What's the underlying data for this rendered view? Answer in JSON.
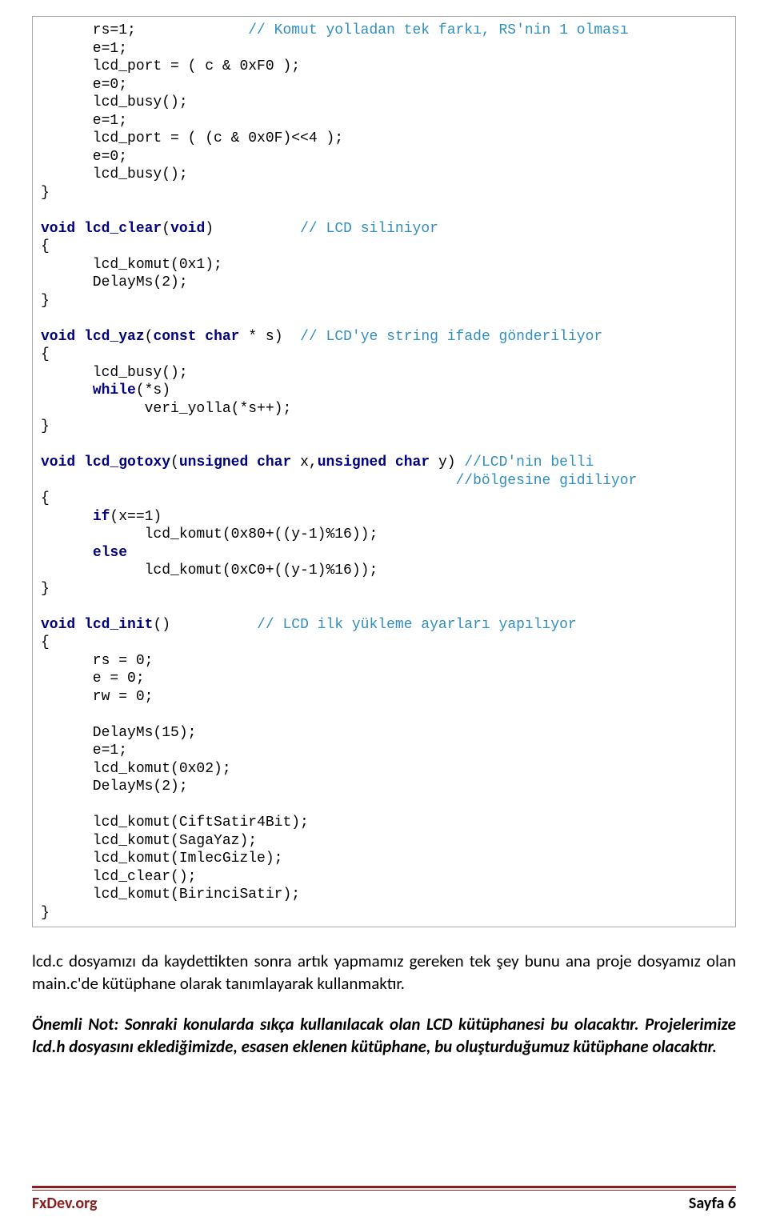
{
  "code": {
    "l1a": "      rs=1;             ",
    "l1b": "// Komut yolladan tek farkı, RS'nin 1 olması",
    "l2": "      e=1;",
    "l3": "      lcd_port = ( c & 0xF0 );",
    "l4": "      e=0;",
    "l5": "      lcd_busy();",
    "l6": "      e=1;",
    "l7": "      lcd_port = ( (c & 0x0F)<<4 );",
    "l8": "      e=0;",
    "l9": "      lcd_busy();",
    "l10": "}",
    "l12a": "void",
    "l12b": " lcd_clear",
    "l12c": "(",
    "l12d": "void",
    "l12e": ")          ",
    "l12f": "// LCD siliniyor",
    "l13": "{",
    "l14": "      lcd_komut(0x1);",
    "l15": "      DelayMs(2);",
    "l16": "}",
    "l18a": "void",
    "l18b": " lcd_yaz",
    "l18c": "(",
    "l18d": "const char",
    "l18e": " * s)  ",
    "l18f": "// LCD'ye string ifade gönderiliyor",
    "l19": "{",
    "l20": "      lcd_busy();",
    "l21a": "      ",
    "l21b": "while",
    "l21c": "(*s)",
    "l22": "            veri_yolla(*s++);",
    "l23": "}",
    "l25a": "void",
    "l25b": " lcd_gotoxy",
    "l25c": "(",
    "l25d": "unsigned char",
    "l25e": " x,",
    "l25f": "unsigned char",
    "l25g": " y) ",
    "l25h": "//LCD'nin belli",
    "l26": "                                                //bölgesine gidiliyor",
    "l27": "{",
    "l28a": "      ",
    "l28b": "if",
    "l28c": "(x==1)",
    "l29": "            lcd_komut(0x80+((y-1)%16));",
    "l30a": "      ",
    "l30b": "else",
    "l31": "            lcd_komut(0xC0+((y-1)%16));",
    "l32": "}",
    "l34a": "void",
    "l34b": " lcd_init",
    "l34c": "()          ",
    "l34d": "// LCD ilk yükleme ayarları yapılıyor",
    "l35": "{",
    "l36": "      rs = 0;",
    "l37": "      e = 0;",
    "l38": "      rw = 0;",
    "l40": "      DelayMs(15);",
    "l41": "      e=1;",
    "l42": "      lcd_komut(0x02);",
    "l43": "      DelayMs(2);",
    "l45": "      lcd_komut(CiftSatir4Bit);",
    "l46": "      lcd_komut(SagaYaz);",
    "l47": "      lcd_komut(ImlecGizle);",
    "l48": "      lcd_clear();",
    "l49": "      lcd_komut(BirinciSatir);",
    "l50": "}"
  },
  "para1": "lcd.c dosyamızı da kaydettikten sonra artık yapmamız gereken tek şey bunu ana proje dosyamız olan main.c'de kütüphane olarak tanımlayarak kullanmaktır.",
  "para2": "Önemli Not: Sonraki konularda sıkça kullanılacak olan LCD kütüphanesi bu olacaktır. Projelerimize lcd.h dosyasını eklediğimizde, esasen eklenen kütüphane, bu oluşturduğumuz kütüphane olacaktır.",
  "footer": {
    "left": "FxDev.org",
    "right": "Sayfa 6"
  }
}
